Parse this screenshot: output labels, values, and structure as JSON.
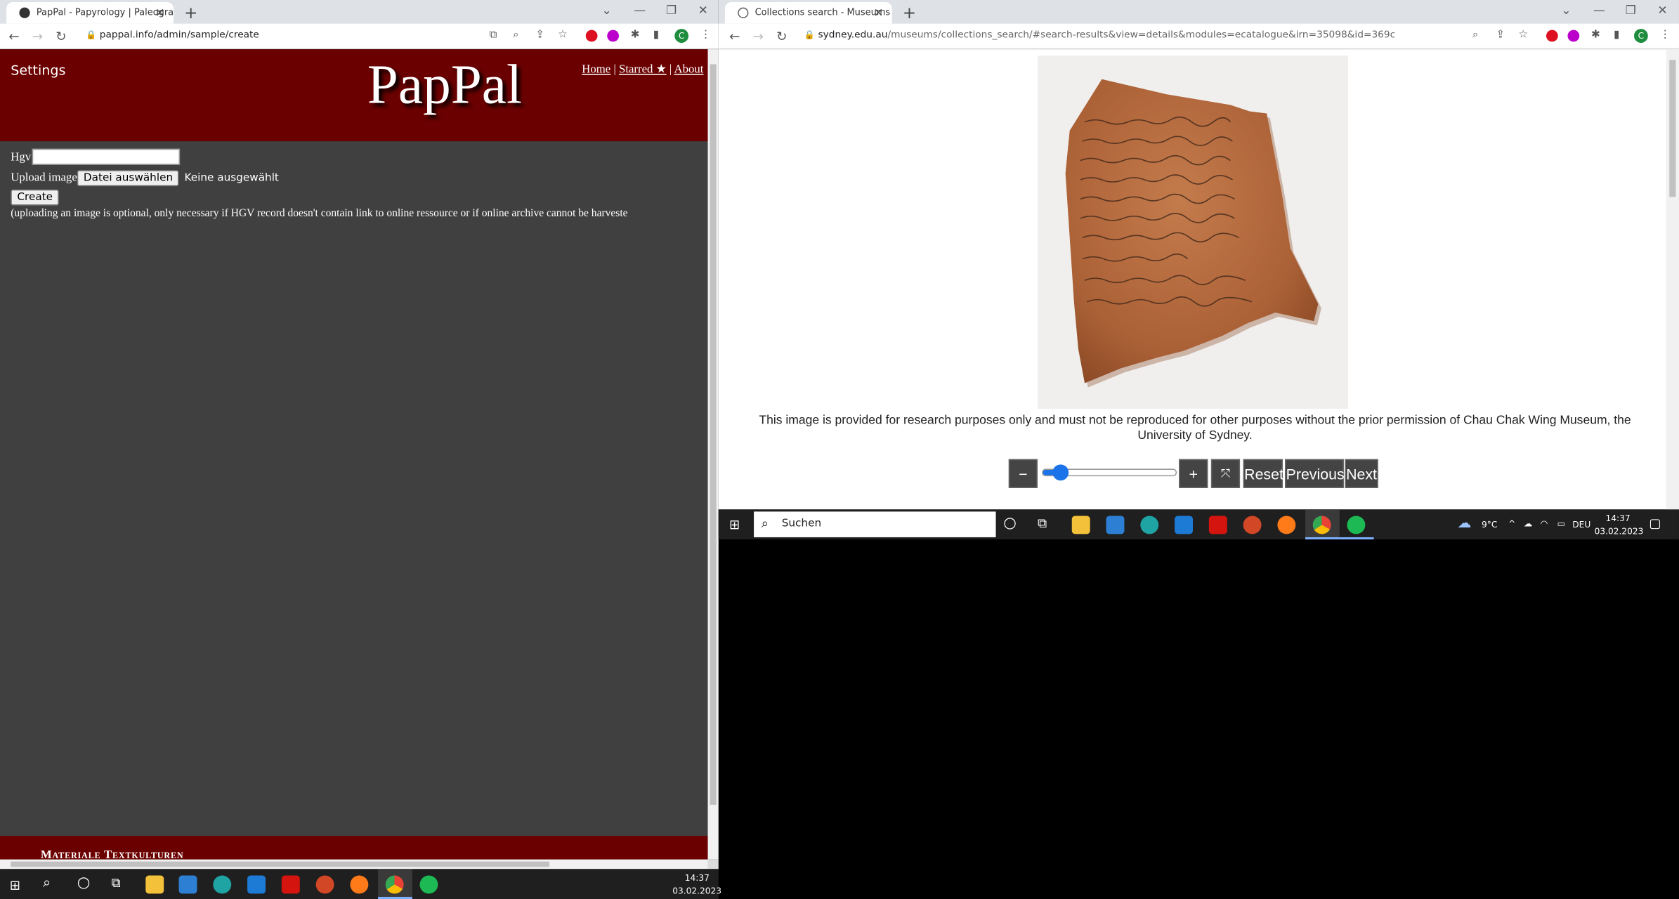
{
  "left_window": {
    "tab_title": "PapPal - Papyrology | Paleograph",
    "url": "pappal.info/admin/sample/create",
    "page": {
      "settings_label": "Settings",
      "logo_text": "PapPal",
      "nav": {
        "home": "Home",
        "separator": "|",
        "starred": "Starred ★",
        "about": "About"
      },
      "form": {
        "hgv_label": "Hgv",
        "hgv_value": "",
        "upload_label": "Upload image",
        "file_button": "Datei auswählen",
        "file_status": "Keine ausgewählt",
        "create_button": "Create",
        "note": "(uploading an image is optional, only necessary if HGV record doesn't contain link to online ressource or if online archive cannot be harveste"
      },
      "footer_text": "Materiale Textkulturen"
    }
  },
  "right_window": {
    "tab_title": "Collections search - Museums - T",
    "url_host": "sydney.edu.au",
    "url_path": "/museums/collections_search/#search-results&view=details&modules=ecatalogue&irn=35098&id=369c",
    "page": {
      "caption": "This image is provided for research purposes only and must not be reproduced for other purposes without the prior permission of Chau Chak Wing Museum, the University of Sydney.",
      "controls": {
        "zoom_out": "−",
        "zoom_in": "+",
        "fit": "⤧",
        "reset": "Reset",
        "previous": "Previous",
        "next": "Next"
      },
      "zoom_level": 0.13
    }
  },
  "taskbar_right": {
    "search_placeholder": "Suchen",
    "weather": "9°C",
    "language": "DEU",
    "time": "14:37",
    "date": "03.02.2023"
  },
  "taskbar_left": {
    "time": "14:37",
    "date": "03.02.2023"
  },
  "colors": {
    "pappal_header": "#6b0000",
    "pappal_body": "#404040",
    "taskbar": "#1f1f1f",
    "accent_blue": "#1a73e8",
    "ostracon": "#b36a3e"
  }
}
